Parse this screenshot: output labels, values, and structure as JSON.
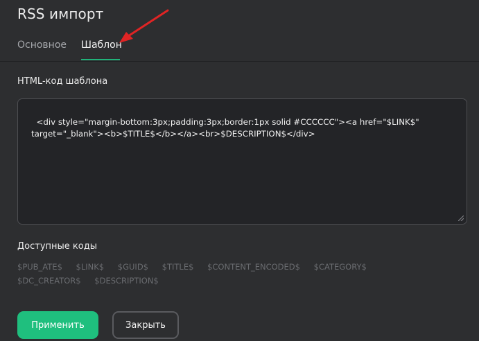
{
  "header": {
    "title": "RSS импорт"
  },
  "tabs": [
    {
      "label": "Основное",
      "active": false
    },
    {
      "label": "Шаблон",
      "active": true
    }
  ],
  "template_section": {
    "label": "HTML-код шаблона",
    "code": "<div style=\"margin-bottom:3px;padding:3px;border:1px solid #CCCCCC\"><a href=\"$LINK$\" target=\"_blank\"><b>$TITLE$</b></a><br>$DESCRIPTION$</div>"
  },
  "available_codes": {
    "label": "Доступные коды",
    "codes": [
      "$PUB_ATE$",
      "$LINK$",
      "$GUID$",
      "$TITLE$",
      "$CONTENT_ENCODED$",
      "$CATEGORY$",
      "$DC_CREATOR$",
      "$DESCRIPTION$"
    ]
  },
  "buttons": {
    "apply": "Применить",
    "close": "Закрыть"
  },
  "colors": {
    "background": "#2d2e30",
    "accent": "#1fbf7e",
    "annotation_arrow": "#e02424",
    "muted_text": "#6a6c70"
  },
  "icons": {
    "annotation": "red-arrow-icon",
    "resize": "resize-grip-icon"
  }
}
